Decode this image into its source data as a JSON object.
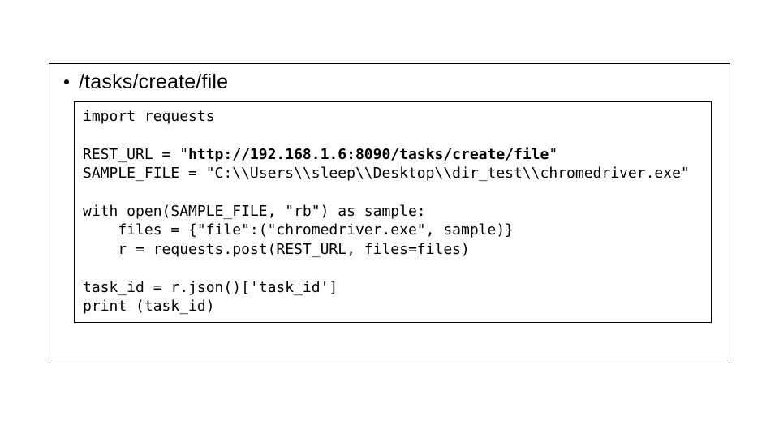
{
  "bullet": {
    "text": "/tasks/create/file"
  },
  "code": {
    "line1": "import requests",
    "blank1": "",
    "line2_prefix": "REST_URL = \"",
    "line2_bold": "http://192.168.1.6:8090/tasks/create/file",
    "line2_suffix": "\"",
    "line3": "SAMPLE_FILE = \"C:\\\\Users\\\\sleep\\\\Desktop\\\\dir_test\\\\chromedriver.exe\"",
    "blank2": "",
    "line4": "with open(SAMPLE_FILE, \"rb\") as sample:",
    "line5": "    files = {\"file\":(\"chromedriver.exe\", sample)}",
    "line6": "    r = requests.post(REST_URL, files=files)",
    "blank3": "",
    "line7": "task_id = r.json()['task_id']",
    "line8": "print (task_id)"
  }
}
